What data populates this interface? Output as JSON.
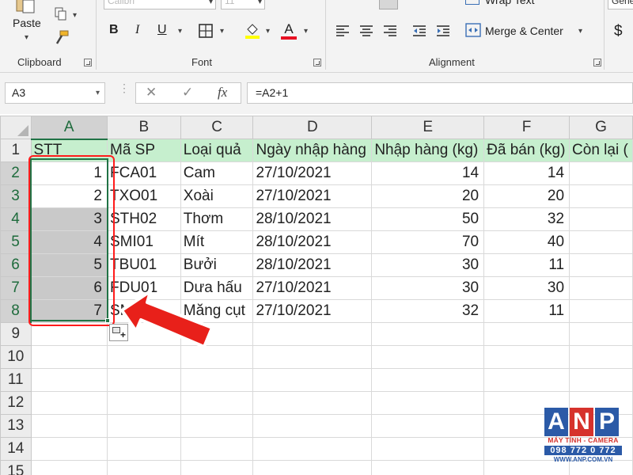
{
  "ribbon": {
    "clipboard": {
      "paste_label": "Paste",
      "group_label": "Clipboard"
    },
    "font": {
      "font_name": "Calibri",
      "font_size": "11",
      "bold_label": "B",
      "italic_label": "I",
      "underline_label": "U",
      "font_color_label": "A",
      "font_color": "#e81123",
      "fill_color": "#ffff00",
      "group_label": "Font"
    },
    "alignment": {
      "wrap_text_label": "Wrap Text",
      "merge_center_label": "Merge & Center",
      "group_label": "Alignment"
    },
    "number": {
      "format_label": "Gene",
      "currency_symbol": "$"
    }
  },
  "formula_bar": {
    "name_box": "A3",
    "cancel_icon": "✕",
    "enter_icon": "✓",
    "fx_label": "fx",
    "formula": "=A2+1"
  },
  "sheet": {
    "corner": "",
    "columns": [
      "A",
      "B",
      "C",
      "D",
      "E",
      "F",
      "G"
    ],
    "selected_column": "A",
    "rows": [
      {
        "num": "1",
        "cells": [
          "STT",
          "Mã SP",
          "Loại quả",
          "Ngày nhập hàng",
          "Nhập hàng (kg)",
          "Đã bán (kg)",
          "Còn lại ("
        ]
      },
      {
        "num": "2",
        "cells": [
          "1",
          "FCA01",
          "Cam",
          "27/10/2021",
          "14",
          "14",
          ""
        ]
      },
      {
        "num": "3",
        "cells": [
          "2",
          "TXO01",
          "Xoài",
          "27/10/2021",
          "20",
          "20",
          ""
        ]
      },
      {
        "num": "4",
        "cells": [
          "3",
          "STH02",
          "Thơm",
          "28/10/2021",
          "50",
          "32",
          ""
        ]
      },
      {
        "num": "5",
        "cells": [
          "4",
          "SMI01",
          "Mít",
          "28/10/2021",
          "70",
          "40",
          ""
        ]
      },
      {
        "num": "6",
        "cells": [
          "5",
          "TBU01",
          "Bưởi",
          "28/10/2021",
          "30",
          "11",
          ""
        ]
      },
      {
        "num": "7",
        "cells": [
          "6",
          "FDU01",
          "Dưa hấu",
          "27/10/2021",
          "30",
          "30",
          ""
        ]
      },
      {
        "num": "8",
        "cells": [
          "7",
          "SMA",
          "Măng cụt",
          "27/10/2021",
          "32",
          "11",
          ""
        ]
      },
      {
        "num": "9",
        "cells": [
          "",
          "",
          "",
          "",
          "",
          "",
          ""
        ]
      },
      {
        "num": "10",
        "cells": [
          "",
          "",
          "",
          "",
          "",
          "",
          ""
        ]
      },
      {
        "num": "11",
        "cells": [
          "",
          "",
          "",
          "",
          "",
          "",
          ""
        ]
      },
      {
        "num": "12",
        "cells": [
          "",
          "",
          "",
          "",
          "",
          "",
          ""
        ]
      },
      {
        "num": "13",
        "cells": [
          "",
          "",
          "",
          "",
          "",
          "",
          ""
        ]
      },
      {
        "num": "14",
        "cells": [
          "",
          "",
          "",
          "",
          "",
          "",
          ""
        ]
      },
      {
        "num": "15",
        "cells": [
          "",
          "",
          "",
          "",
          "",
          "",
          ""
        ]
      }
    ],
    "header_fill": "#c6efce",
    "selection_color": "#217346"
  },
  "annotation": {
    "highlight_color": "#ff1c1c"
  },
  "watermark": {
    "letters": [
      "A",
      "N",
      "P"
    ],
    "letter_colors": [
      "#2b5aa7",
      "#d6322c",
      "#2b5aa7"
    ],
    "tagline": "MÁY TÍNH - CAMERA",
    "phone": "098 772 0 772",
    "website": "WWW.ANP.COM.VN"
  }
}
